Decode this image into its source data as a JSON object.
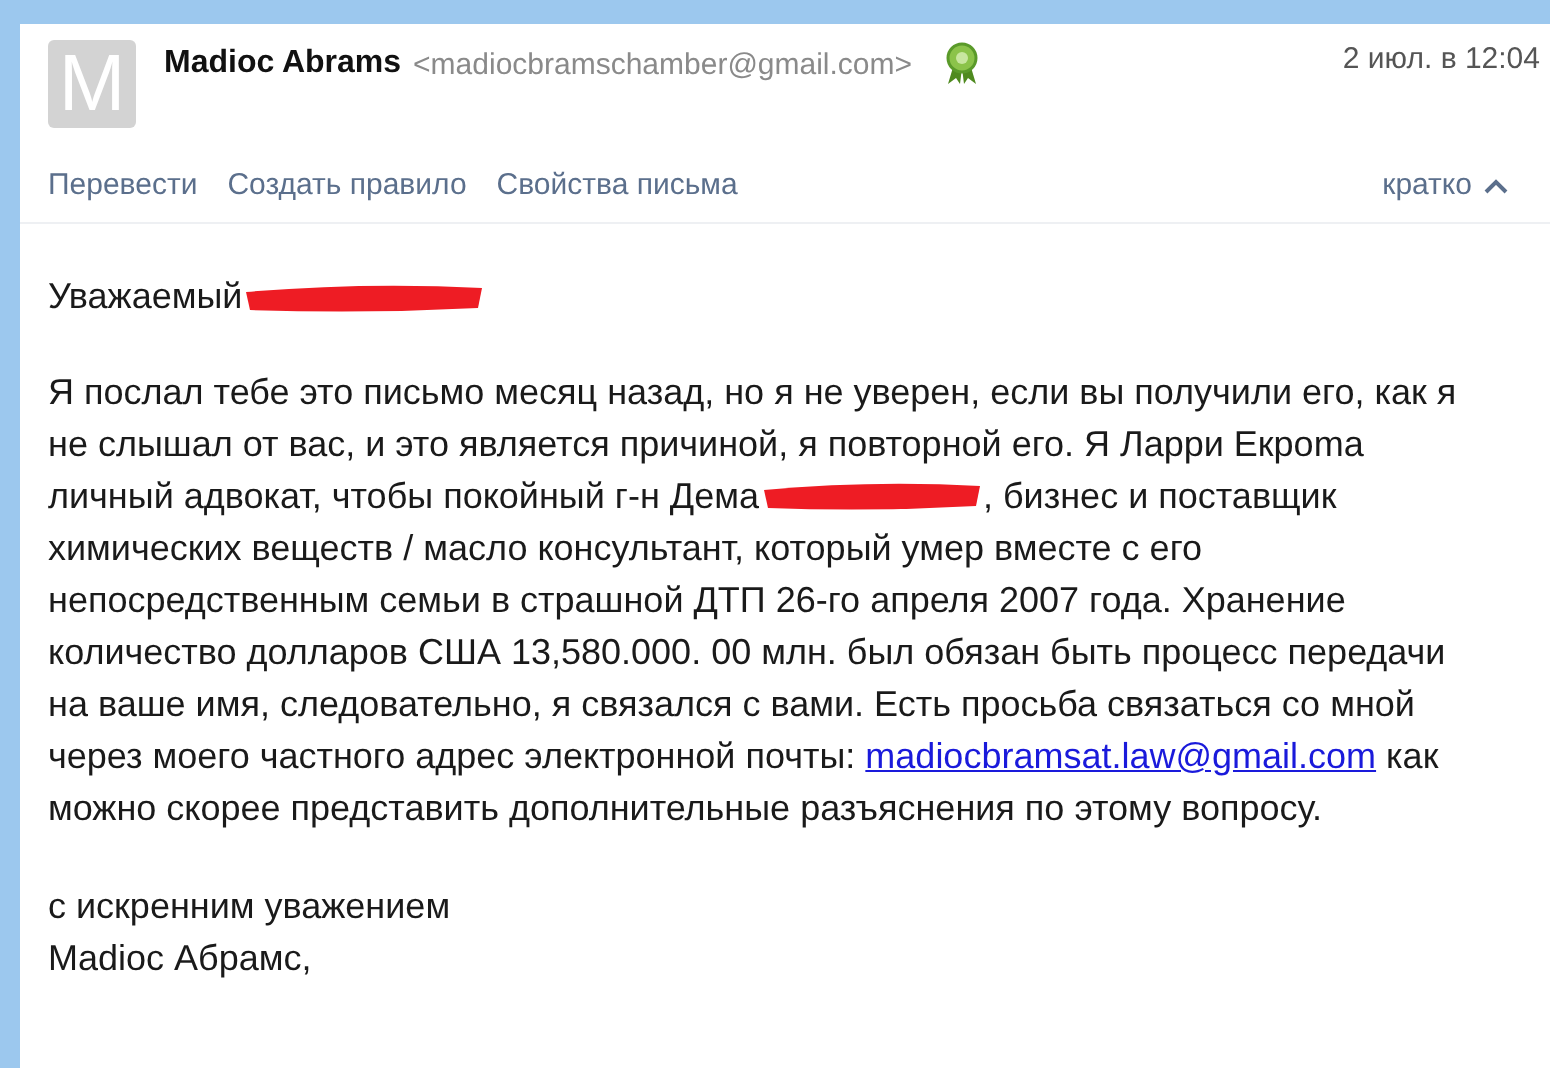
{
  "header": {
    "avatar_letter": "M",
    "sender_name": "Madioc Abrams",
    "sender_email": "<madiocbramschamber@gmail.com>",
    "verified": true,
    "date": "2 июл. в 12:04"
  },
  "actions": [
    {
      "label": "Перевести"
    },
    {
      "label": "Создать правило"
    },
    {
      "label": "Свойства письма"
    }
  ],
  "view_toggle": {
    "label": "кратко",
    "expanded": true
  },
  "greeting": {
    "text": "Уважаемый",
    "redacted": true
  },
  "paragraph": [
    {
      "kind": "text",
      "text": "Я послал тебе это письмо месяц назад, но я не уверен, если вы получили его, как я\nне слышал от вас, и это является причиной, я повторной его. Я Ларри Екроmа\nличный адвокат, чтобы покойный г-н Дема"
    },
    {
      "kind": "redaction"
    },
    {
      "kind": "text",
      "text": ", бизнес и поставщик\nхимических веществ / масло консультант, который умер вместе с его\nнепосредственным семьи в страшной ДТП 26-го апреля 2007 года. Хранение\nколичество долларов США 13,580.000. 00 млн. был обязан быть процесс передачи\nна ваше имя, следовательно, я связался с вами. Есть просьба связаться со мной\nчерез моего частного адрес электронной почты: "
    },
    {
      "kind": "link",
      "text": "madiocbramsat.law@gmail.com"
    },
    {
      "kind": "text",
      "text": "  как\nможно скорее представить дополнительные разъяснения по этому вопросу."
    }
  ],
  "closing": "с искренним уважением\nMadioc Абрамс,"
}
